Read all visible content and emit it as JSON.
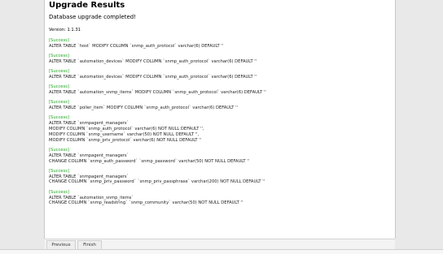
{
  "page": {
    "title": "Upgrade Results",
    "subtitle": "Database upgrade completed!",
    "version": "Version: 1.1.31"
  },
  "results": [
    {
      "status": "[Success]",
      "lines": [
        "ALTER TABLE `host` MODIFY COLUMN `snmp_auth_protocol` varchar(6) DEFAULT ''"
      ]
    },
    {
      "status": "[Success]",
      "lines": [
        "ALTER TABLE `automation_devices` MODIFY COLUMN `snmp_auth_protocol` varchar(6) DEFAULT ''"
      ]
    },
    {
      "status": "[Success]",
      "lines": [
        "ALTER TABLE `automation_devices` MODIFY COLUMN `snmp_auth_protocol` varchar(6) DEFAULT ''"
      ]
    },
    {
      "status": "[Success]",
      "lines": [
        "ALTER TABLE `automation_snmp_items` MODIFY COLUMN `snmp_auth_protocol` varchar(6) DEFAULT ''"
      ]
    },
    {
      "status": "[Success]",
      "lines": [
        "ALTER TABLE `poller_item` MODIFY COLUMN `snmp_auth_protocol` varchar(6) DEFAULT ''"
      ]
    },
    {
      "status": "[Success]",
      "lines": [
        "ALTER TABLE `snmpagent_managers`",
        "MODIFY COLUMN `snmp_auth_protocol` varchar(6) NOT NULL DEFAULT '',",
        "MODIFY COLUMN `snmp_username` varchar(50) NOT NULL DEFAULT '',",
        "MODIFY COLUMN `snmp_priv_protocol` varchar(6) NOT NULL DEFAULT ''"
      ]
    },
    {
      "status": "[Success]",
      "lines": [
        "ALTER TABLE `snmpagent_managers`",
        "CHANGE COLUMN `snmp_auth_password` `snmp_password` varchar(50) NOT NULL DEFAULT ''"
      ]
    },
    {
      "status": "[Success]",
      "lines": [
        "ALTER TABLE `snmpagent_managers`",
        "CHANGE COLUMN `snmp_priv_password` `snmp_priv_passphrase` varchar(200) NOT NULL DEFAULT ''"
      ]
    },
    {
      "status": "[Success]",
      "lines": [
        "ALTER TABLE `automation_snmp_items`",
        "CHANGE COLUMN `snmp_readstring` `snmp_community` varchar(50) NOT NULL DEFAULT ''"
      ]
    }
  ],
  "footer": {
    "previous_label": "Previous",
    "finish_label": "Finish"
  },
  "colors": {
    "success": "#22a622",
    "text": "#222222",
    "panel": "#ffffff",
    "background": "#e9e9e9"
  }
}
